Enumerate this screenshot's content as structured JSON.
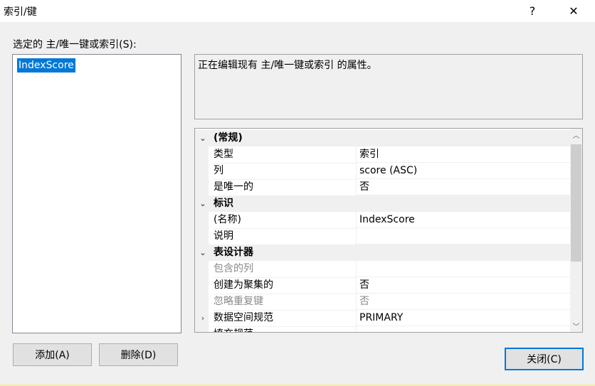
{
  "window": {
    "title": "索引/键",
    "help_label": "?",
    "close_label": "✕"
  },
  "list": {
    "label": "选定的 主/唯一键或索引(S):",
    "selected_item": "IndexScore"
  },
  "description": "正在编辑现有 主/唯一键或索引 的属性。",
  "grid": {
    "rows": [
      {
        "kind": "category",
        "expander": "⌄",
        "name": "(常规)",
        "value": ""
      },
      {
        "kind": "prop",
        "expander": "",
        "name": "类型",
        "value": "索引",
        "disabled": false
      },
      {
        "kind": "prop",
        "expander": "",
        "name": "列",
        "value": "score (ASC)",
        "disabled": false
      },
      {
        "kind": "prop",
        "expander": "",
        "name": "是唯一的",
        "value": "否",
        "disabled": false
      },
      {
        "kind": "category",
        "expander": "⌄",
        "name": "标识",
        "value": ""
      },
      {
        "kind": "prop",
        "expander": "",
        "name": "(名称)",
        "value": "IndexScore",
        "disabled": false
      },
      {
        "kind": "prop",
        "expander": "",
        "name": "说明",
        "value": "",
        "disabled": false
      },
      {
        "kind": "category",
        "expander": "⌄",
        "name": "表设计器",
        "value": ""
      },
      {
        "kind": "prop",
        "expander": "",
        "name": "包含的列",
        "value": "",
        "disabled": true
      },
      {
        "kind": "prop",
        "expander": "",
        "name": "创建为聚集的",
        "value": "否",
        "disabled": false
      },
      {
        "kind": "prop",
        "expander": "",
        "name": "忽略重复键",
        "value": "否",
        "disabled": true
      },
      {
        "kind": "prop",
        "expander": "›",
        "name": "数据空间规范",
        "value": "PRIMARY",
        "disabled": false
      },
      {
        "kind": "prop",
        "expander": "›",
        "name": "填充规范",
        "value": "",
        "disabled": false
      }
    ]
  },
  "buttons": {
    "add": "添加(A)",
    "delete": "删除(D)",
    "close": "关闭(C)"
  }
}
